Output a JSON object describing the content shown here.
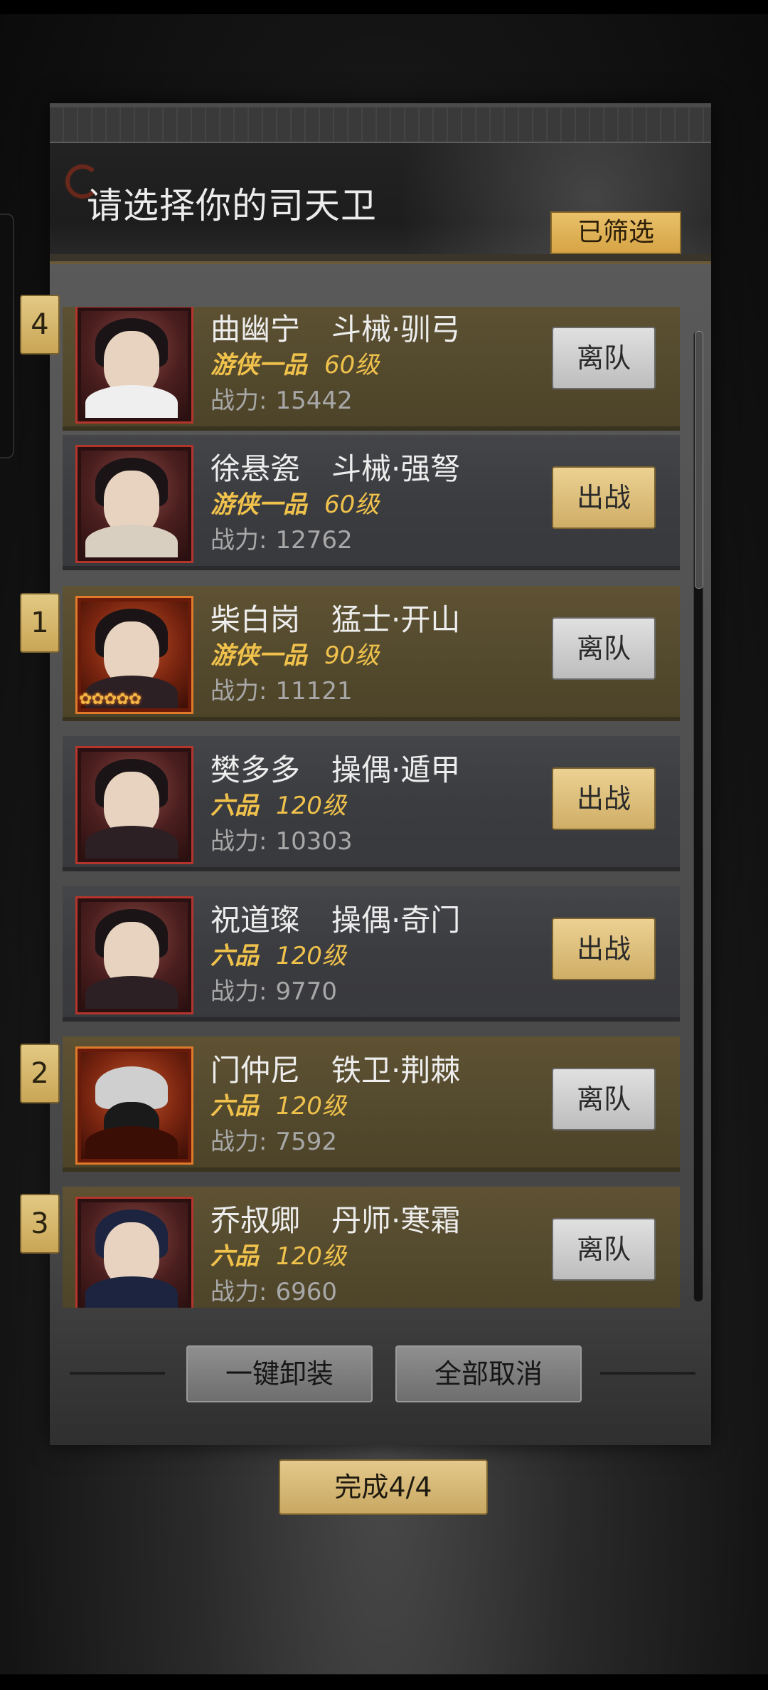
{
  "header": {
    "title": "请选择你的司天卫",
    "filter_label": "已筛选"
  },
  "roster": [
    {
      "slot": "4",
      "name": "曲幽宁",
      "class": "斗械·驯弓",
      "rank": "游侠一品",
      "level": "60级",
      "power_label": "战力:",
      "power": "15442",
      "action": "离队",
      "selected": true,
      "stars": 0
    },
    {
      "slot": "",
      "name": "徐悬瓷",
      "class": "斗械·强弩",
      "rank": "游侠一品",
      "level": "60级",
      "power_label": "战力:",
      "power": "12762",
      "action": "出战",
      "selected": false,
      "stars": 0
    },
    {
      "slot": "1",
      "name": "柴白岗",
      "class": "猛士·开山",
      "rank": "游侠一品",
      "level": "90级",
      "power_label": "战力:",
      "power": "11121",
      "action": "离队",
      "selected": true,
      "stars": 5
    },
    {
      "slot": "",
      "name": "樊多多",
      "class": "操偶·遁甲",
      "rank": "六品",
      "level": "120级",
      "power_label": "战力:",
      "power": "10303",
      "action": "出战",
      "selected": false,
      "stars": 0
    },
    {
      "slot": "",
      "name": "祝道璨",
      "class": "操偶·奇门",
      "rank": "六品",
      "level": "120级",
      "power_label": "战力:",
      "power": "9770",
      "action": "出战",
      "selected": false,
      "stars": 0
    },
    {
      "slot": "2",
      "name": "门仲尼",
      "class": "铁卫·荆棘",
      "rank": "六品",
      "level": "120级",
      "power_label": "战力:",
      "power": "7592",
      "action": "离队",
      "selected": true,
      "stars": 0
    },
    {
      "slot": "3",
      "name": "乔叔卿",
      "class": "丹师·寒霜",
      "rank": "六品",
      "level": "120级",
      "power_label": "战力:",
      "power": "6960",
      "action": "离队",
      "selected": true,
      "stars": 0
    }
  ],
  "footer": {
    "unequip_label": "一键卸装",
    "cancel_all_label": "全部取消",
    "done_label": "完成4/4"
  },
  "colors": {
    "accent_gold": "#e9c16a",
    "selected_card": "#544a2e",
    "unselected_card": "#3b3c40",
    "rank_text": "#f0c24c",
    "portrait_border": "#b3352c"
  }
}
